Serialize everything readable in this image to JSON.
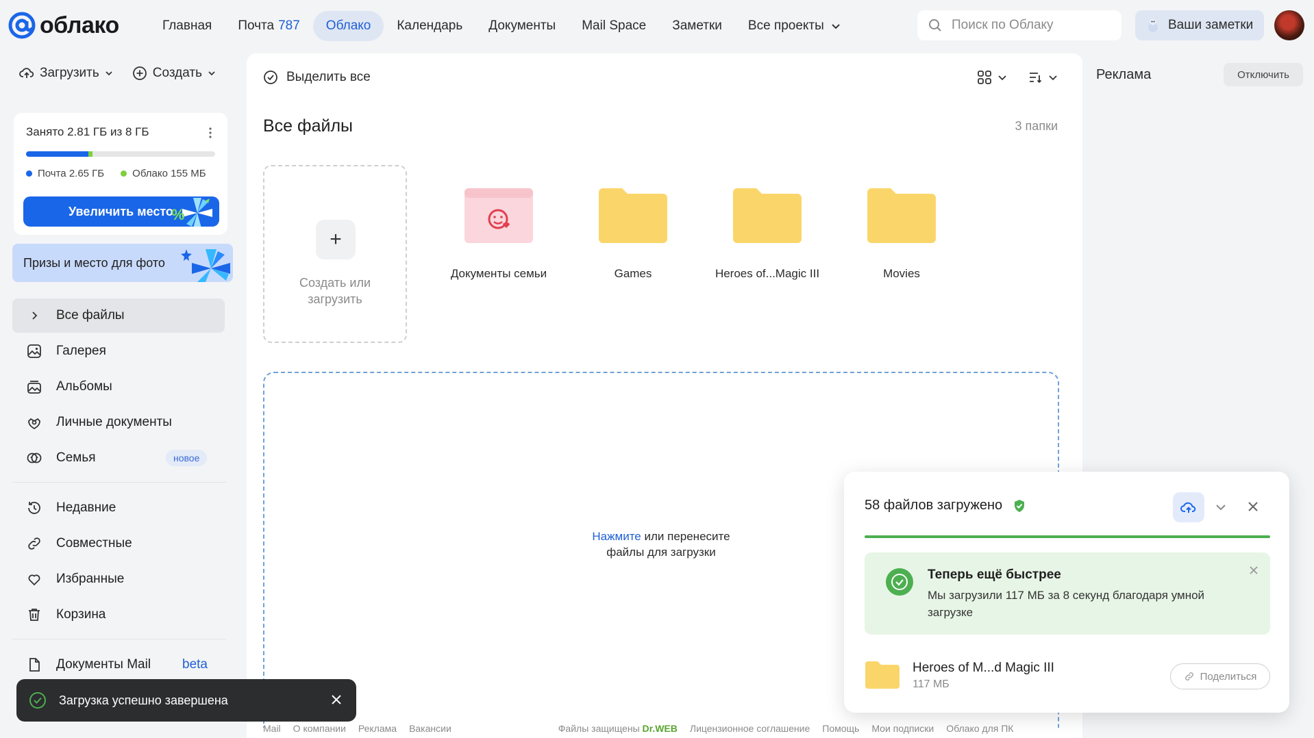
{
  "brand": {
    "name": "облако"
  },
  "topnav": {
    "items": [
      {
        "label": "Главная"
      },
      {
        "label": "Почта",
        "count": "787"
      },
      {
        "label": "Облако"
      },
      {
        "label": "Календарь"
      },
      {
        "label": "Документы"
      },
      {
        "label": "Mail Space"
      },
      {
        "label": "Заметки"
      },
      {
        "label": "Все проекты"
      }
    ],
    "search_placeholder": "Поиск по Облаку",
    "notes_button": "Ваши заметки"
  },
  "sidebar": {
    "upload_label": "Загрузить",
    "create_label": "Создать",
    "storage": {
      "used_text": "Занято 2.81 ГБ из 8 ГБ",
      "mail_fraction": 0.33,
      "cloud_fraction": 0.02,
      "mail_label": "Почта 2.65 ГБ",
      "cloud_label": "Облако 155 МБ",
      "increase_button": "Увеличить место"
    },
    "promo": "Призы и место для фото",
    "items": [
      {
        "label": "Все файлы",
        "icon": "chevron-right-icon"
      },
      {
        "label": "Галерея",
        "icon": "gallery-icon"
      },
      {
        "label": "Альбомы",
        "icon": "albums-icon"
      },
      {
        "label": "Личные документы",
        "icon": "documents-icon"
      },
      {
        "label": "Семья",
        "icon": "family-icon",
        "badge": "новое"
      },
      {
        "label": "Недавние",
        "icon": "history-icon"
      },
      {
        "label": "Совместные",
        "icon": "link-icon"
      },
      {
        "label": "Избранные",
        "icon": "heart-icon"
      },
      {
        "label": "Корзина",
        "icon": "trash-icon"
      },
      {
        "label": "Документы Mail",
        "icon": "file-icon",
        "badge": "beta"
      }
    ]
  },
  "main": {
    "select_all": "Выделить все",
    "title": "Все файлы",
    "folder_count": "3 папки",
    "create_tile": {
      "line1": "Создать или",
      "line2": "загрузить"
    },
    "folders": [
      {
        "name": "Документы семьи",
        "kind": "family"
      },
      {
        "name": "Games",
        "kind": "folder"
      },
      {
        "name": "Heroes of...Magic III",
        "kind": "folder"
      },
      {
        "name": "Movies",
        "kind": "folder"
      }
    ],
    "dropzone": {
      "link": "Нажмите",
      "text1": " или перенесите",
      "text2": "файлы для загрузки"
    }
  },
  "ads": {
    "title": "Реклама",
    "disable": "Отключить"
  },
  "upload_panel": {
    "title": "58 файлов загружено",
    "progress": 1.0,
    "notice_title": "Теперь ещё быстрее",
    "notice_text": "Мы загрузили 117 МБ за 8 секунд благодаря умной загрузке",
    "file_name": "Heroes of M...d Magic III",
    "file_size": "117 МБ",
    "share": "Поделиться"
  },
  "toast": {
    "text": "Загрузка успешно завершена"
  },
  "footer": {
    "links": [
      "Mail",
      "О компании",
      "Реклама",
      "Вакансии"
    ],
    "protected": "Файлы защищены",
    "drweb": "Dr.WEB",
    "links2": [
      "Лицензионное соглашение",
      "Помощь",
      "Мои подписки",
      "Облако для ПК"
    ]
  },
  "colors": {
    "accent": "#1a66e8",
    "success": "#4caf50",
    "folder": "#fad66a",
    "cloud_dot": "#7ed03c"
  }
}
